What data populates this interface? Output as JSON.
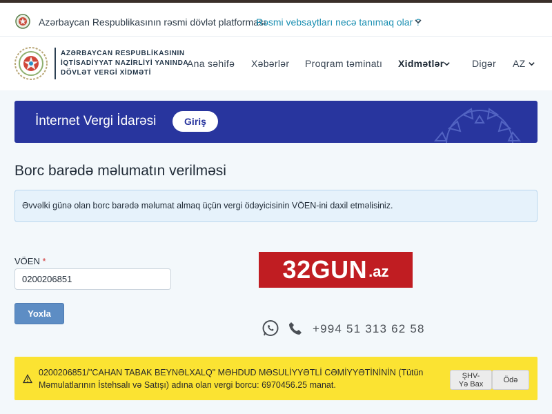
{
  "gov_bar": {
    "text": "Azərbaycan Respublikasının rəsmi dövlət platforması",
    "link": "Rəsmi vebsaytları necə tanımaq olar ?"
  },
  "header": {
    "org_line1": "AZƏRBAYCAN RESPUBLİKASININ",
    "org_line2": "İQTİSADİYYAT NAZİRLİYİ YANINDA",
    "org_line3": "DÖVLƏT VERGİ XİDMƏTİ",
    "nav": [
      "Ana səhifə",
      "Xəbərlər",
      "Proqram təminatı",
      "Xidmətlər",
      "Digər",
      "AZ"
    ]
  },
  "banner": {
    "title": "İnternet Vergi İdarəsi",
    "login_label": "Giriş"
  },
  "page": {
    "title": "Borc barədə məlumatın verilməsi",
    "info": "Əvvəlki günə olan borc barədə məlumat almaq üçün vergi ödəyicisinin VÖEN-ini daxil etməlisiniz."
  },
  "form": {
    "voen_label": "VÖEN",
    "required_mark": "*",
    "voen_value": "0200206851",
    "submit_label": "Yoxla"
  },
  "watermark": {
    "brand": "32GUN",
    "tld": ".az",
    "phone": "+994 51 313 62 58"
  },
  "result": {
    "text": "0200206851/\"CAHAN TABAK BEYNƏLXALQ\" MƏHDUD MƏSULİYYƏTLİ CƏMİYYƏTİNİNİN (Tütün Məmulatlarının İstehsalı və Satışı) adına olan vergi borcu: 6970456.25 manat.",
    "shv_line1": "ŞHV-",
    "shv_line2": "Yə Bax",
    "pay_label": "Ödə"
  },
  "colors": {
    "banner": "#28359e",
    "link": "#1b8fb2",
    "warning": "#fbe332",
    "primary_button": "#5d8dc4",
    "promo_red": "#c01d22"
  },
  "icons": [
    "emblem-icon",
    "chevron-down-icon",
    "whatsapp-icon",
    "phone-icon",
    "warning-icon"
  ]
}
